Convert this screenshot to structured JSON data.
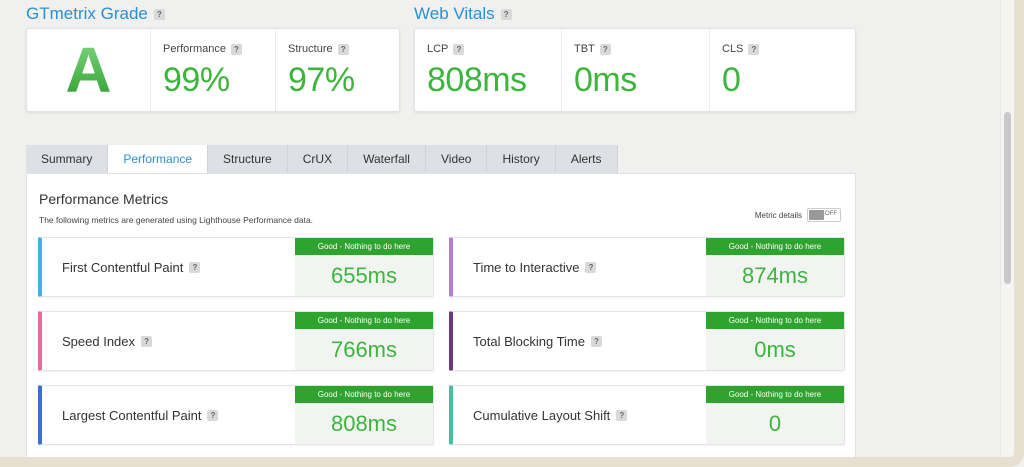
{
  "grade": {
    "title": "GTmetrix Grade",
    "letter": "A",
    "performance_label": "Performance",
    "performance_value": "99%",
    "structure_label": "Structure",
    "structure_value": "97%"
  },
  "vitals": {
    "title": "Web Vitals",
    "lcp_label": "LCP",
    "lcp_value": "808ms",
    "tbt_label": "TBT",
    "tbt_value": "0ms",
    "cls_label": "CLS",
    "cls_value": "0"
  },
  "help_glyph": "?",
  "tabs": [
    {
      "label": "Summary"
    },
    {
      "label": "Performance",
      "active": true
    },
    {
      "label": "Structure"
    },
    {
      "label": "CrUX"
    },
    {
      "label": "Waterfall"
    },
    {
      "label": "Video"
    },
    {
      "label": "History"
    },
    {
      "label": "Alerts"
    }
  ],
  "panel": {
    "title": "Performance Metrics",
    "subtitle": "The following metrics are generated using Lighthouse Performance data.",
    "metric_details_label": "Metric details",
    "toggle_state": "OFF"
  },
  "metrics": [
    {
      "name": "First Contentful Paint",
      "badge": "Good - Nothing to do here",
      "value": "655ms",
      "color": "#3fb3e8"
    },
    {
      "name": "Time to Interactive",
      "badge": "Good - Nothing to do here",
      "value": "874ms",
      "color": "#b87be0"
    },
    {
      "name": "Speed Index",
      "badge": "Good - Nothing to do here",
      "value": "766ms",
      "color": "#e86a9b"
    },
    {
      "name": "Total Blocking Time",
      "badge": "Good - Nothing to do here",
      "value": "0ms",
      "color": "#6b3a7c"
    },
    {
      "name": "Largest Contentful Paint",
      "badge": "Good - Nothing to do here",
      "value": "808ms",
      "color": "#3a6fd4"
    },
    {
      "name": "Cumulative Layout Shift",
      "badge": "Good - Nothing to do here",
      "value": "0",
      "color": "#3fc4a1"
    }
  ],
  "colors": {
    "accent": "#2a8fd4",
    "good": "#3db53d",
    "badge": "#2ea32e"
  }
}
